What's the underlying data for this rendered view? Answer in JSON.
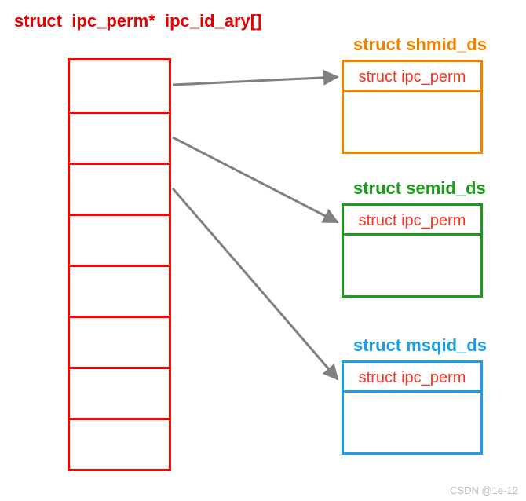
{
  "header": {
    "title": "struct  ipc_perm*  ipc_id_ary[]"
  },
  "array": {
    "cell_count": 8
  },
  "structs": {
    "shm": {
      "title": "struct shmid_ds",
      "inner": "struct ipc_perm"
    },
    "sem": {
      "title": "struct semid_ds",
      "inner": "struct ipc_perm"
    },
    "msq": {
      "title": "struct msqid_ds",
      "inner": "struct ipc_perm"
    }
  },
  "watermark": "CSDN @1e-12"
}
